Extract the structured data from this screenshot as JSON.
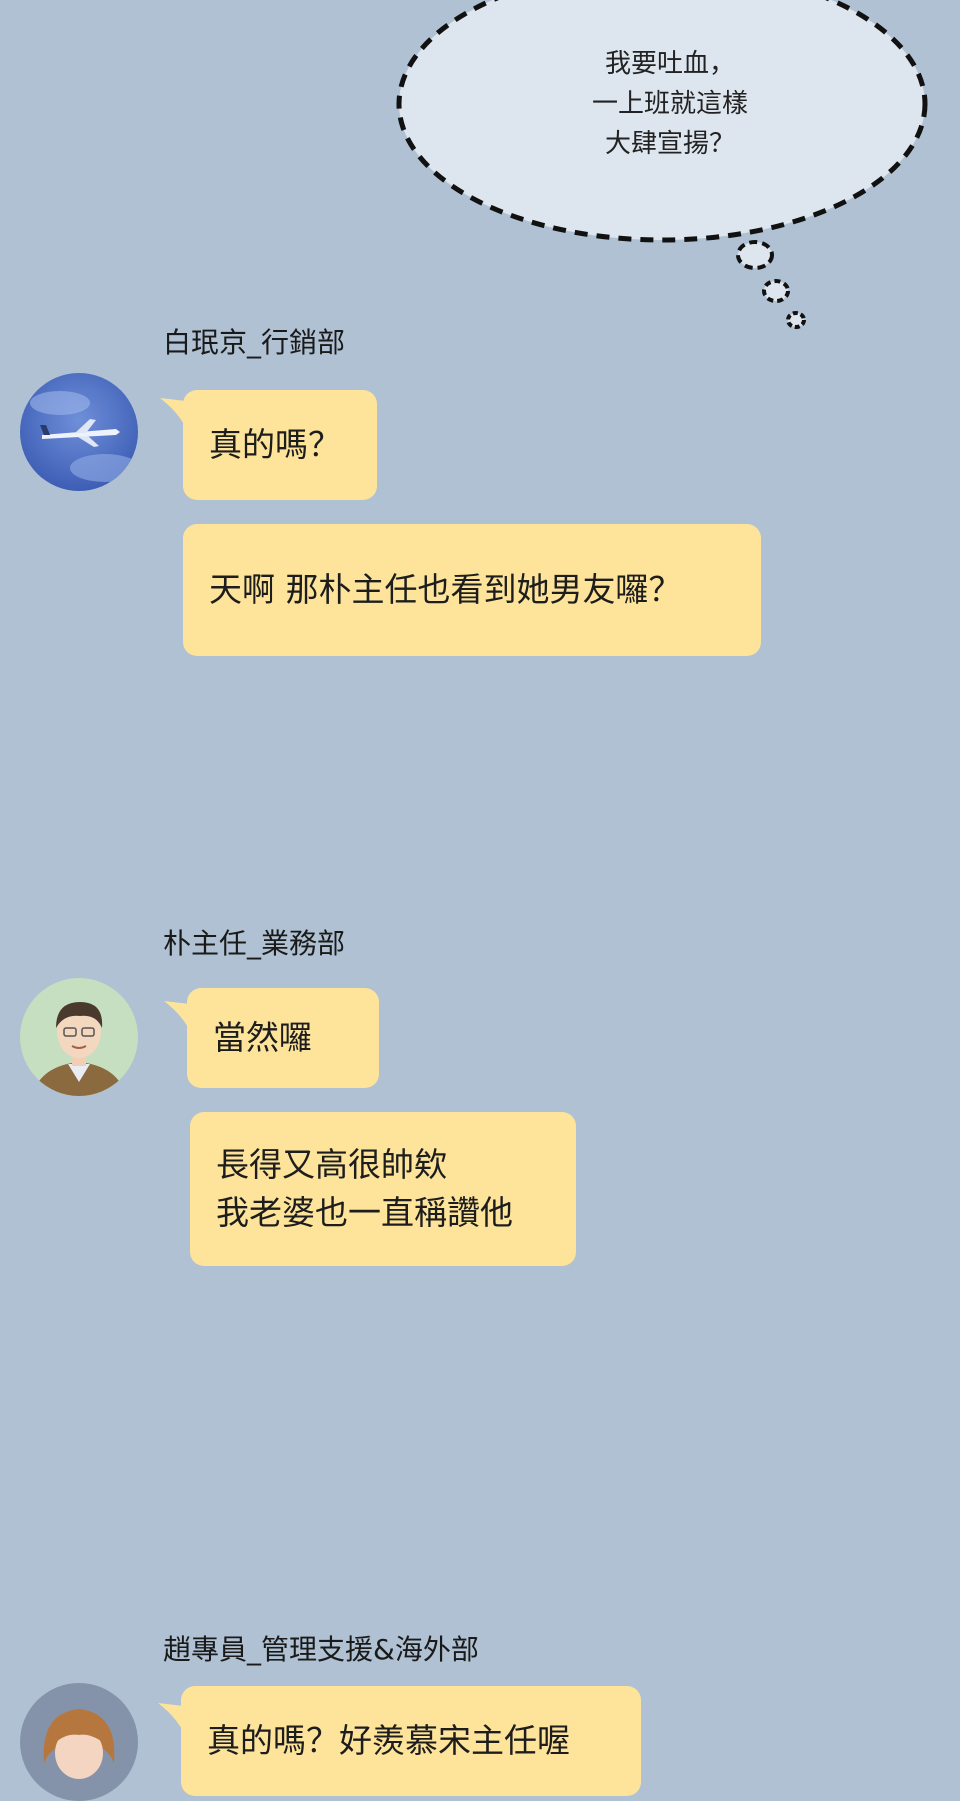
{
  "thought": {
    "lines": [
      "我要吐血，",
      "一上班就這樣",
      "大肆宣揚？"
    ]
  },
  "groups": [
    {
      "sender": "白珉京_行銷部",
      "avatar_icon": "airplane-sky-avatar",
      "messages": [
        {
          "lines": [
            "真的嗎？"
          ]
        },
        {
          "lines": [
            "天啊 那朴主任也看到她男友囉？"
          ]
        }
      ]
    },
    {
      "sender": "朴主任_業務部",
      "avatar_icon": "man-portrait-avatar",
      "messages": [
        {
          "lines": [
            "當然囉"
          ]
        },
        {
          "lines": [
            "長得又高很帥欸",
            "我老婆也一直稱讚他"
          ]
        }
      ]
    },
    {
      "sender": "趙專員_管理支援&海外部",
      "avatar_icon": "woman-portrait-avatar",
      "messages": [
        {
          "lines": [
            "真的嗎？好羨慕宋主任喔"
          ]
        }
      ]
    }
  ],
  "colors": {
    "background": "#afc1d2",
    "bubble": "#fde49a",
    "thought_fill": "#dde5ee"
  }
}
